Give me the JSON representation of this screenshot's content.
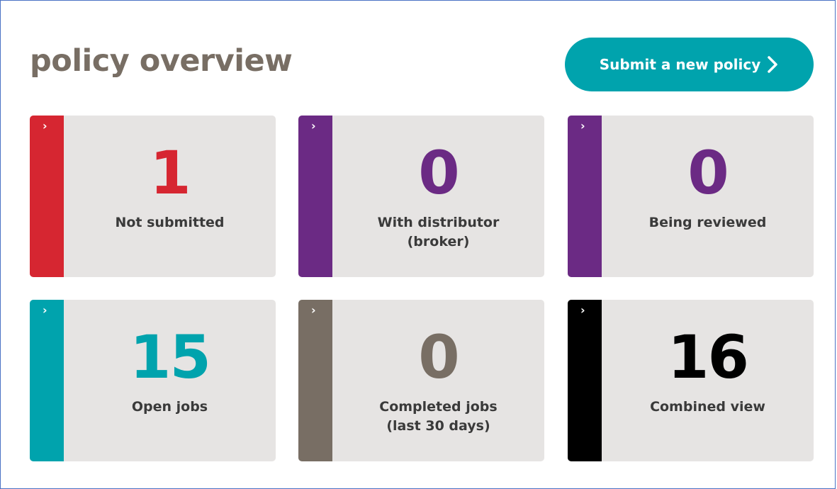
{
  "header": {
    "title": "policy overview",
    "submit_label": "Submit a new policy"
  },
  "colors": {
    "red": "#d62631",
    "purple": "#6b2a84",
    "teal": "#00a3ad",
    "taupe": "#786e64",
    "black": "#000000",
    "card_bg": "#e6e4e3"
  },
  "cards": [
    {
      "arrow": "›",
      "number": "1",
      "label": "Not submitted"
    },
    {
      "arrow": "›",
      "number": "0",
      "label": "With distributor (broker)"
    },
    {
      "arrow": "›",
      "number": "0",
      "label": "Being reviewed"
    },
    {
      "arrow": "›",
      "number": "15",
      "label": "Open jobs"
    },
    {
      "arrow": "›",
      "number": "0",
      "label": "Completed jobs (last 30 days)"
    },
    {
      "arrow": "›",
      "number": "16",
      "label": "Combined view"
    }
  ]
}
